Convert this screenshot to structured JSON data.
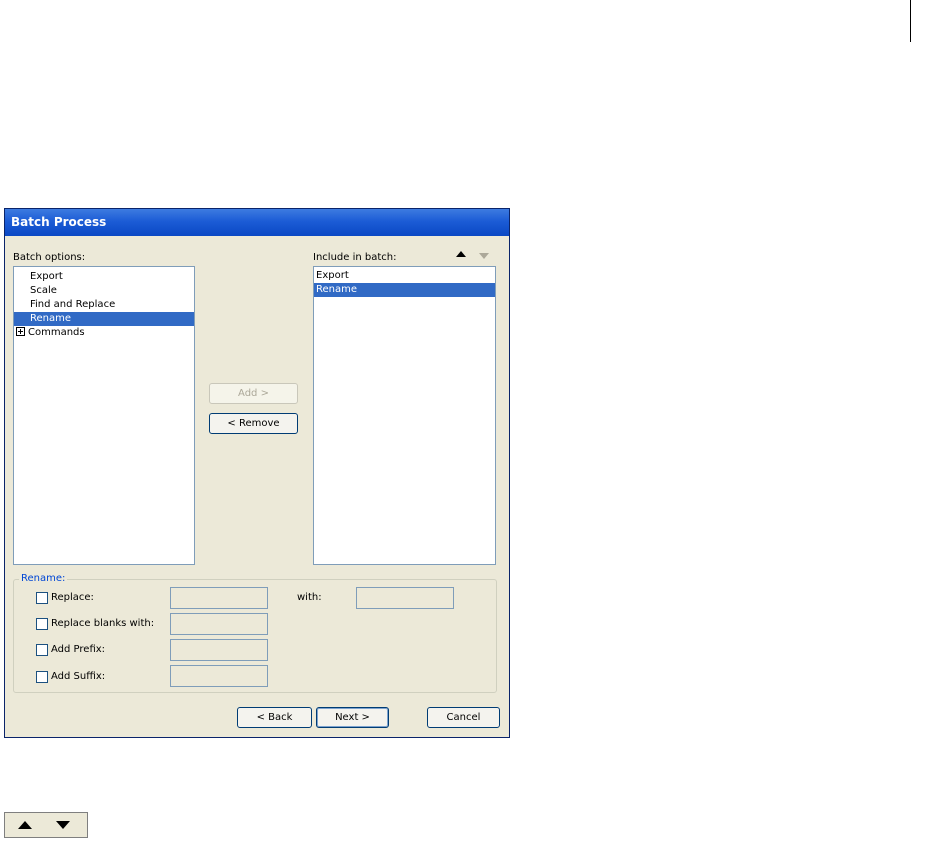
{
  "dialog": {
    "title": "Batch Process",
    "batch_options_label": "Batch options:",
    "include_label": "Include in batch:",
    "batch_options": [
      {
        "label": "Export",
        "selected": false
      },
      {
        "label": "Scale",
        "selected": false
      },
      {
        "label": "Find and Replace",
        "selected": false
      },
      {
        "label": "Rename",
        "selected": true
      },
      {
        "label": "Commands",
        "selected": false,
        "expandable": true
      }
    ],
    "include_items": [
      {
        "label": "Export",
        "selected": false
      },
      {
        "label": "Rename",
        "selected": true
      }
    ],
    "add_button": "Add >",
    "remove_button": "< Remove",
    "rename_group": {
      "title": "Rename:",
      "replace_label": "Replace:",
      "with_label": "with:",
      "replace_blanks_label": "Replace blanks with:",
      "add_prefix_label": "Add Prefix:",
      "add_suffix_label": "Add Suffix:"
    },
    "back_button": "< Back",
    "next_button": "Next >",
    "cancel_button": "Cancel"
  },
  "colors": {
    "selection": "#316ac5",
    "titlebar": "#0a48c4",
    "dialog_bg": "#ece9d8",
    "group_title": "#0046d5"
  },
  "icons": [
    "move-up-icon",
    "move-down-icon",
    "expand-plus-icon"
  ]
}
